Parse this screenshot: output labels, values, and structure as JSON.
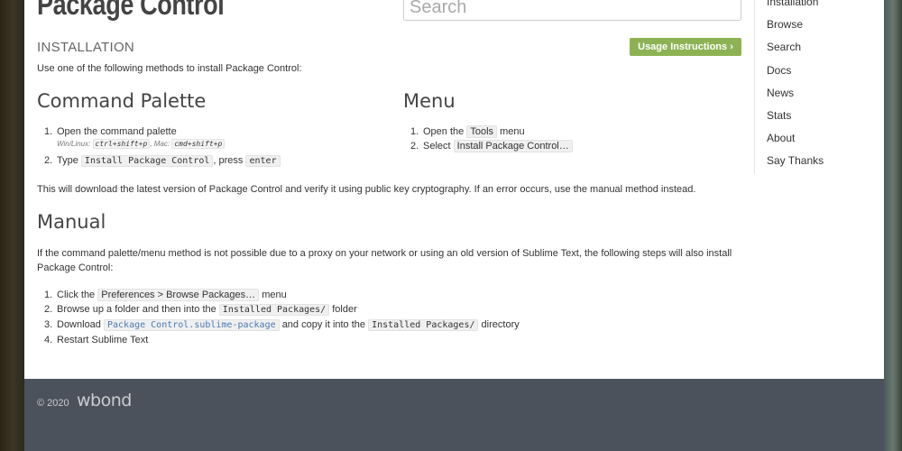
{
  "header": {
    "logo": "Package Control",
    "search_placeholder": "Search"
  },
  "section_tag": "INSTALLATION",
  "usage_button": "Usage Instructions ›",
  "intro": "Use one of the following methods to install Package Control:",
  "command_palette": {
    "title": "Command Palette",
    "steps": [
      {
        "num": "1.",
        "text": "Open the command palette"
      },
      {
        "num": "2.",
        "text_before": "Type",
        "code": "Install Package Control",
        "text_middle": ", press",
        "key": "enter"
      }
    ],
    "hint": {
      "win_label": "Win/Linux:",
      "win_keys": "ctrl+shift+p",
      "sep": ", Mac:",
      "mac_keys": "cmd+shift+p"
    }
  },
  "menu": {
    "title": "Menu",
    "steps": [
      {
        "num": "1.",
        "text_before": "Open the",
        "code": "Tools",
        "text_after": "menu"
      },
      {
        "num": "2.",
        "text_before": "Select",
        "code": "Install Package Control…"
      }
    ]
  },
  "verify_note": "This will download the latest version of Package Control and verify it using public key cryptography. If an error occurs, use the manual method instead.",
  "manual": {
    "title": "Manual",
    "description": "If the command palette/menu method is not possible due to a proxy on your network or using an old version of Sublime Text, the following steps will also install Package Control:",
    "steps": [
      {
        "num": "1.",
        "text_before": "Click the",
        "code": "Preferences > Browse Packages…",
        "text_after": "menu"
      },
      {
        "num": "2.",
        "text_before": "Browse up a folder and then into the",
        "code": "Installed Packages/",
        "text_after": "folder"
      },
      {
        "num": "3.",
        "text_before": "Download",
        "code": "Package Control.sublime-package",
        "text_middle": "and copy it into the",
        "code2": "Installed Packages/",
        "text_after": "directory"
      },
      {
        "num": "4.",
        "text": "Restart Sublime Text"
      }
    ]
  },
  "sidebar": {
    "items": [
      "Installation",
      "Browse",
      "Search",
      "Docs",
      "News",
      "Stats",
      "About",
      "Say Thanks"
    ]
  },
  "footer": {
    "copyright": "© 2020",
    "brand": "wbond"
  },
  "colors": {
    "accent_button": "#8db254",
    "link": "#4a79b5",
    "footer_bg": "#4b525b"
  }
}
